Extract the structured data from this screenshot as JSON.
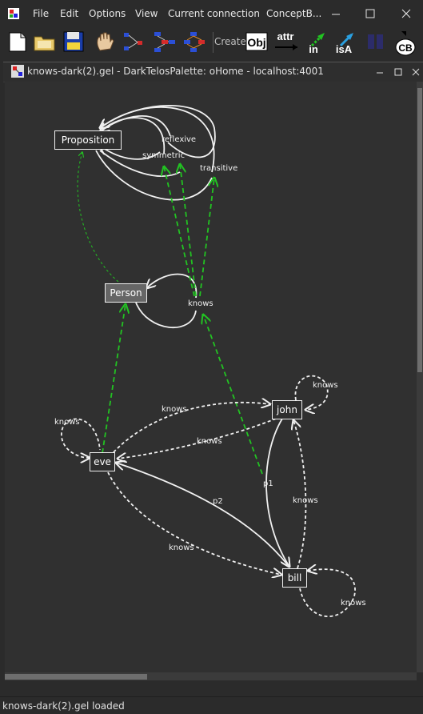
{
  "menu": [
    "File",
    "Edit",
    "Options",
    "View",
    "Current connection",
    "ConceptB..."
  ],
  "window_controls": {
    "minimize": "minimize-icon",
    "maximize": "maximize-icon",
    "close": "close-icon"
  },
  "toolbar": {
    "create_label": "Create",
    "obj_label": "Obj",
    "attr_label": "attr",
    "in_label": "in",
    "isa_label": "isA",
    "cb_label": "CB"
  },
  "document": {
    "title": "knows-dark(2).gel - DarkTelosPalette: oHome - localhost:4001"
  },
  "graph": {
    "nodes": {
      "proposition": "Proposition",
      "person": "Person",
      "john": "john",
      "eve": "eve",
      "bill": "bill"
    },
    "labels": {
      "reflexive": "reflexive",
      "symmetric": "symmetric",
      "transitive": "transitive",
      "knows_person": "knows",
      "knows_eve_self": "knows",
      "knows_eve_john": "knows",
      "knows_john_eve": "knows",
      "knows_john_self": "knows",
      "knows_eve_bill": "knows",
      "knows_bill_john": "knows",
      "knows_bill_self": "knows",
      "p1": "p1",
      "p2": "p2"
    }
  },
  "colors": {
    "background": "#303030",
    "edge_white": "#f0f0f0",
    "edge_green": "#22c322"
  },
  "status": "knows-dark(2).gel loaded"
}
